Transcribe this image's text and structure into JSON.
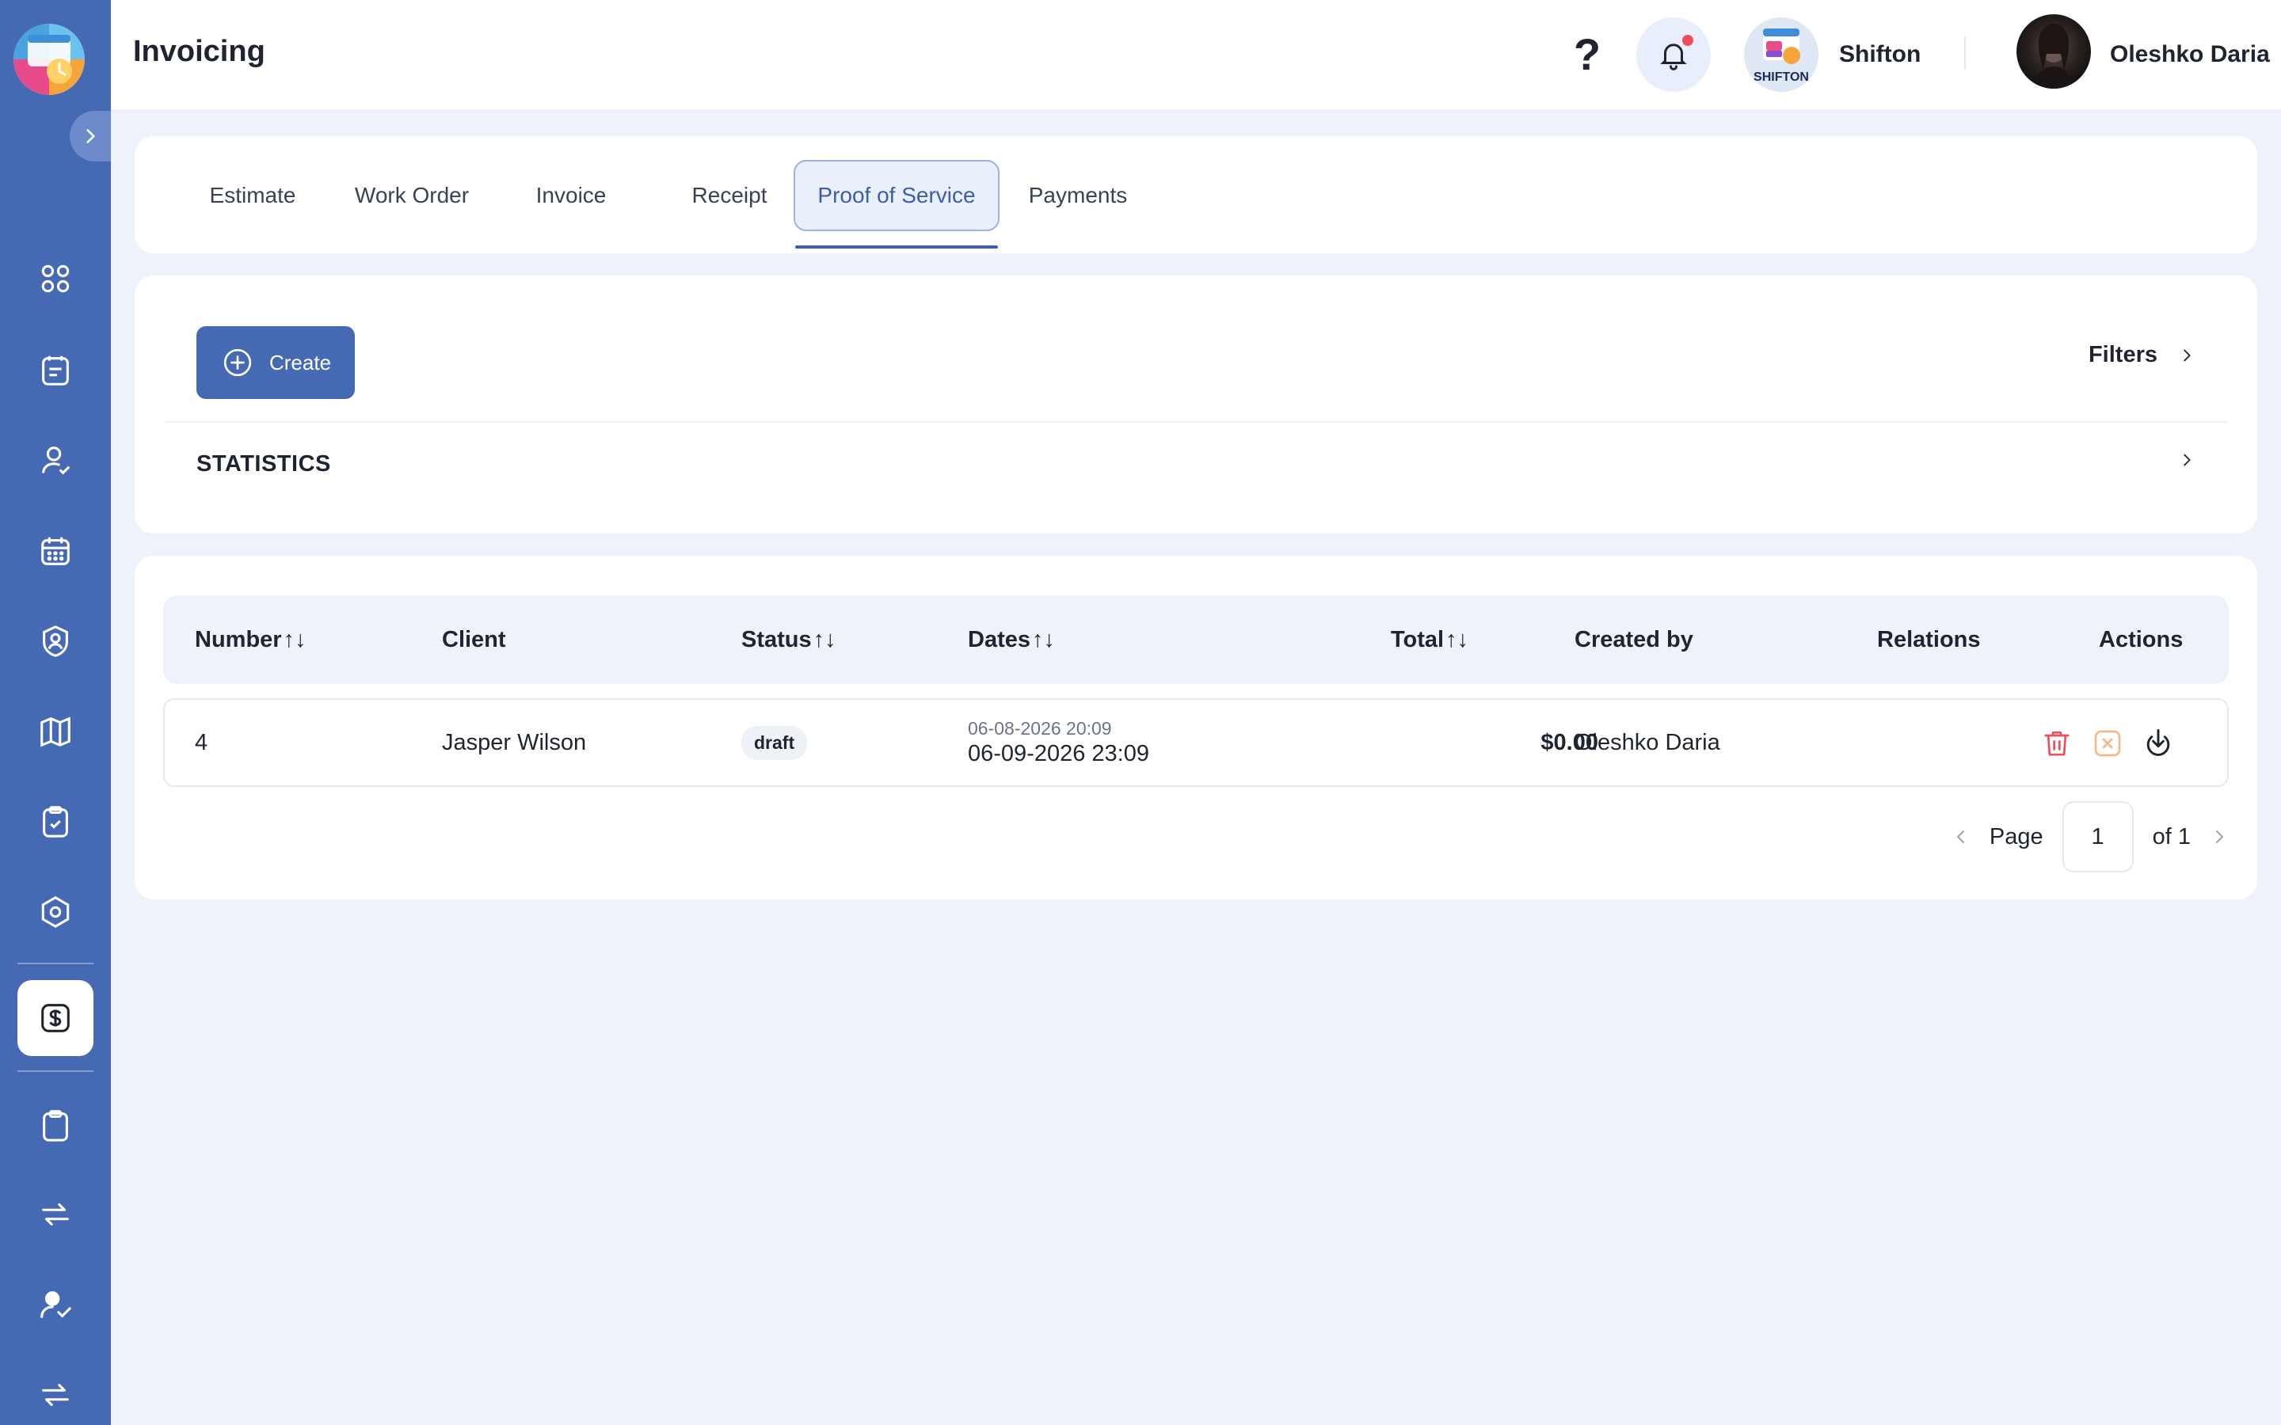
{
  "header": {
    "title": "Invoicing",
    "help_label": "?",
    "company_name": "Shifton",
    "company_logo_text": "SHIFTON",
    "user_name": "Oleshko Daria"
  },
  "tabs": [
    {
      "label": "Estimate",
      "active": false
    },
    {
      "label": "Work Order",
      "active": false
    },
    {
      "label": "Invoice",
      "active": false
    },
    {
      "label": "Receipt",
      "active": false
    },
    {
      "label": "Proof of Service",
      "active": true
    },
    {
      "label": "Payments",
      "active": false
    }
  ],
  "toolbar": {
    "create_label": "Create",
    "filters_label": "Filters",
    "statistics_label": "STATISTICS"
  },
  "table": {
    "columns": {
      "number": "Number",
      "client": "Client",
      "status": "Status",
      "dates": "Dates",
      "total": "Total",
      "created_by": "Created by",
      "relations": "Relations",
      "actions": "Actions"
    },
    "sort_glyph": "↑↓",
    "rows": [
      {
        "number": "4",
        "client": "Jasper Wilson",
        "status": "draft",
        "date_start": "06-08-2026 20:09",
        "date_end": "06-09-2026 23:09",
        "total": "$0.00",
        "created_by": "Oleshko Daria",
        "relations": ""
      }
    ]
  },
  "pagination": {
    "page_label": "Page",
    "current_page": "1",
    "of_label": "of 1"
  },
  "colors": {
    "sidebar": "#4669b3",
    "accent": "#3d5ea6",
    "background": "#eef3fb",
    "delete": "#e8505b",
    "cancel": "#f3b98a"
  },
  "icons": {
    "sidebar": [
      "dashboard-icon",
      "tasks-icon",
      "user-check-icon",
      "calendar-icon",
      "badge-icon",
      "map-icon",
      "clipboard-check-icon",
      "settings-icon",
      "dollar-icon",
      "clipboard-icon",
      "swap-icon",
      "user-approve-icon",
      "swap-icon"
    ]
  }
}
